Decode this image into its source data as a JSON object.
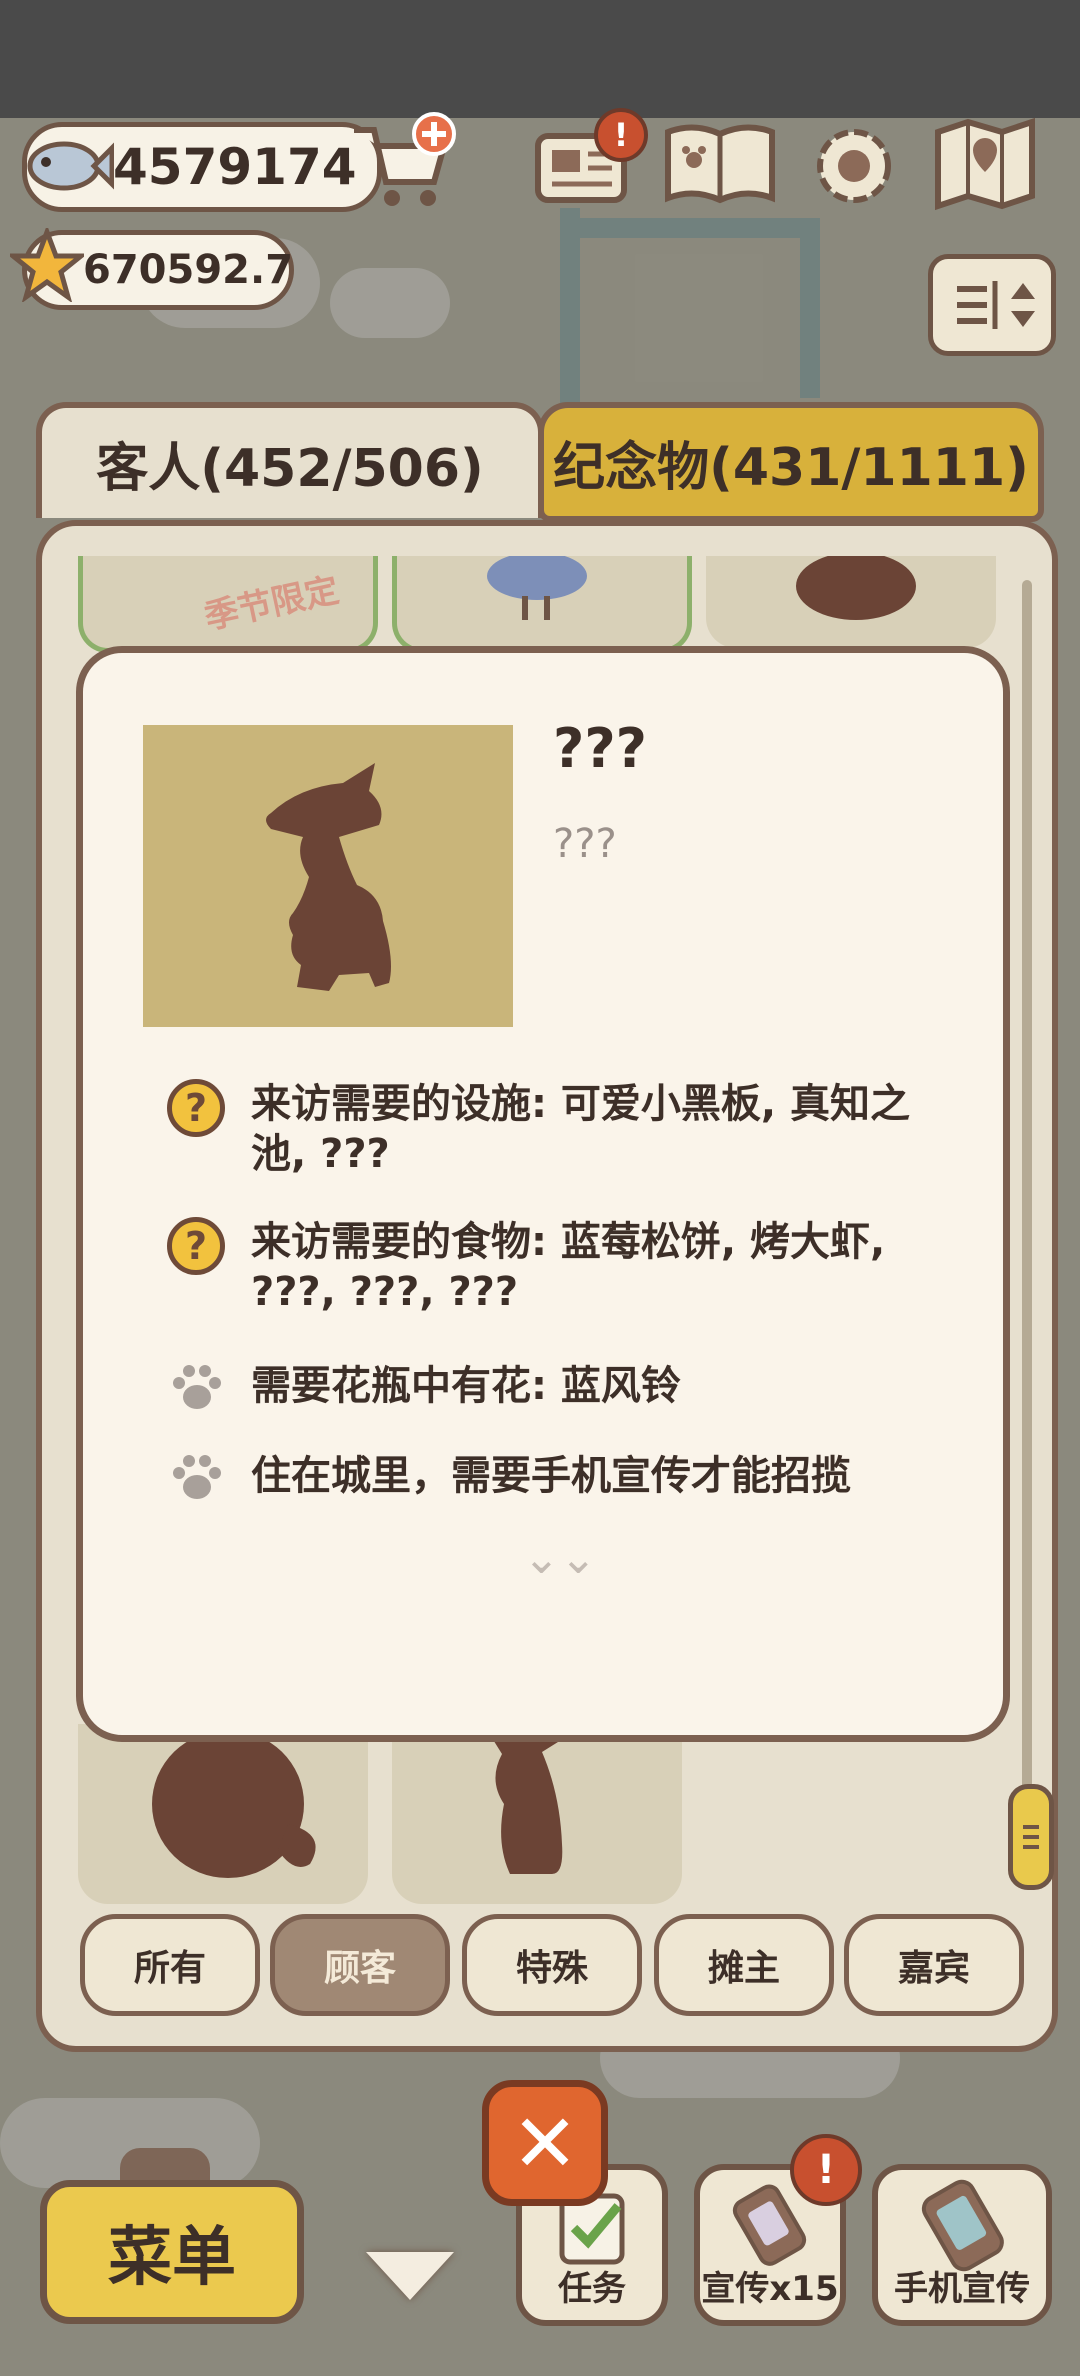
{
  "hud": {
    "fish_currency": "4579174",
    "star_currency": "670592.7",
    "shop_icon": "cart-plus-icon",
    "news_icon": "newspaper-icon",
    "news_badge": "!",
    "guide_icon": "paw-book-icon",
    "settings_icon": "gear-icon",
    "map_icon": "map-icon",
    "sort_icon": "sort-toggle-icon"
  },
  "tabs": {
    "guests": "客人(452/506)",
    "souvenirs": "纪念物(431/1111)"
  },
  "grid": {
    "seasonal_stamp": "季节限定"
  },
  "detail": {
    "name": "???",
    "description": "???",
    "requirements": [
      {
        "icon": "question-icon",
        "text": "来访需要的设施: 可爱小黑板, 真知之池, ???"
      },
      {
        "icon": "question-icon",
        "text": "来访需要的食物: 蓝莓松饼, 烤大虾, ???, ???, ???"
      },
      {
        "icon": "paw-icon",
        "text": "需要花瓶中有花: 蓝风铃"
      },
      {
        "icon": "paw-icon",
        "text": "住在城里，需要手机宣传才能招揽"
      }
    ],
    "more_indicator": "⌄⌄"
  },
  "filters": [
    "所有",
    "顾客",
    "特殊",
    "摊主",
    "嘉宾"
  ],
  "active_filter": "顾客",
  "bottom": {
    "menu": "菜单",
    "close_glyph": "✕",
    "tasks": "任务",
    "promote_ticket": "宣传x15",
    "promote_badge": "!",
    "phone_promote": "手机宣传"
  },
  "colors": {
    "panel_border": "#7c6050",
    "souvenir_tab": "#d8b13b",
    "active_filter": "#a08874",
    "menu_button": "#ebc94e",
    "close_button": "#e0662f"
  }
}
